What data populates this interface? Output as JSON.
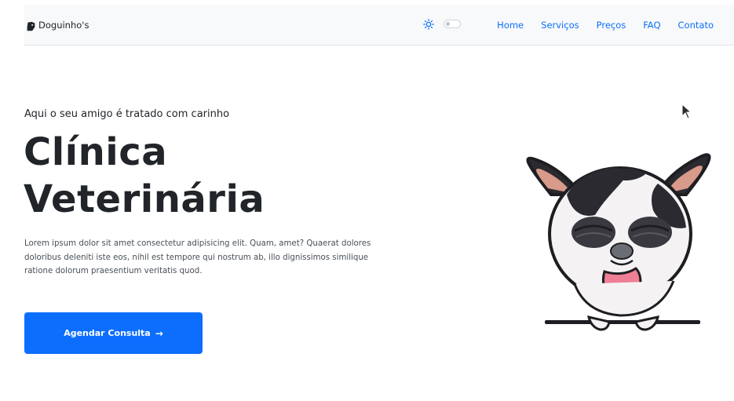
{
  "navbar": {
    "brand": "Doguinho's",
    "brand_icon": "dog-logo-icon",
    "theme_icon": "sun-icon",
    "links": [
      {
        "label": "Home"
      },
      {
        "label": "Serviços"
      },
      {
        "label": "Preços"
      },
      {
        "label": "FAQ"
      },
      {
        "label": "Contato"
      }
    ]
  },
  "hero": {
    "subtitle": "Aqui o seu amigo é tratado com carinho",
    "title": "Clínica Veterinária",
    "description": "Lorem ipsum dolor sit amet consectetur adipisicing elit. Quam, amet? Quaerat dolores doloribus deleniti iste eos, nihil est tempore qui nostrum ab, illo dignissimos similique ratione dolorum praesentium veritatis quod.",
    "cta_label": "Agendar Consulta",
    "cta_icon": "arrow-right-icon",
    "illustration": "dog-illustration"
  },
  "colors": {
    "accent": "#0d6efd",
    "navbar_bg": "#f8f9fa",
    "text": "#212529"
  }
}
